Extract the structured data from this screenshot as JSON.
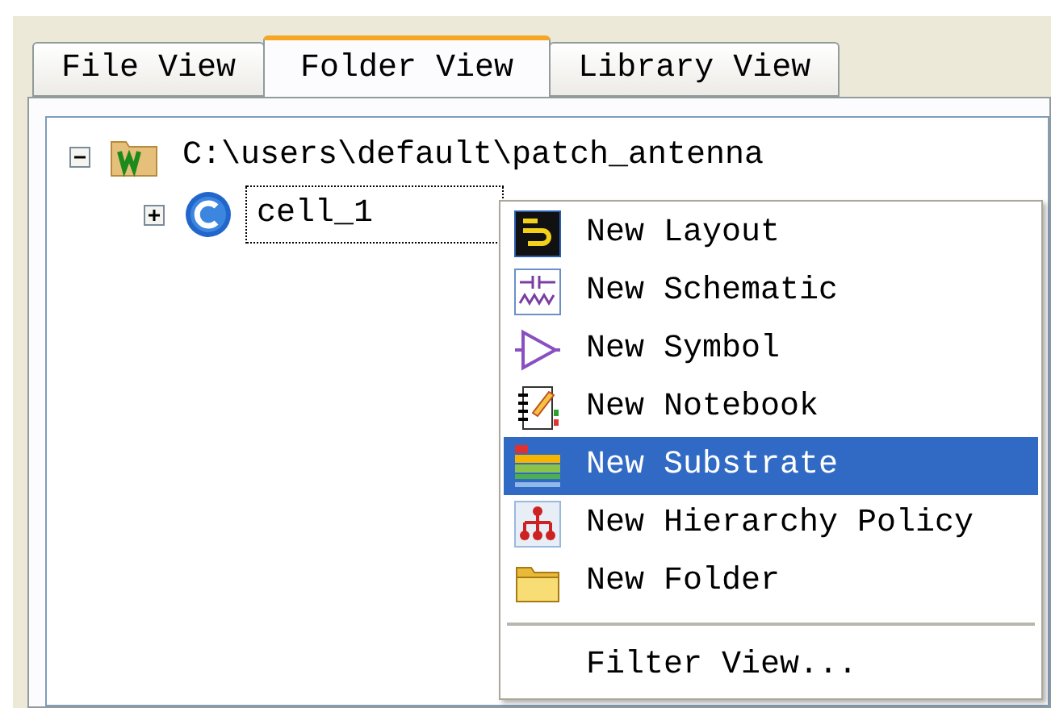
{
  "tabs": [
    {
      "label": "File View",
      "selected": false
    },
    {
      "label": "Folder View",
      "selected": true
    },
    {
      "label": "Library View",
      "selected": false
    }
  ],
  "tree": [
    {
      "label": "C:\\users\\default\\patch_antenna",
      "expanded": true,
      "focused": false,
      "children": [
        {
          "label": "cell_1",
          "expanded": false,
          "focused": true
        }
      ]
    }
  ],
  "context_menu": {
    "items": [
      {
        "kind": "command",
        "label": "New Layout",
        "selected": false
      },
      {
        "kind": "command",
        "label": "New Schematic",
        "selected": false
      },
      {
        "kind": "command",
        "label": "New Symbol",
        "selected": false
      },
      {
        "kind": "command",
        "label": "New Notebook",
        "selected": false
      },
      {
        "kind": "command",
        "label": "New Substrate",
        "selected": true
      },
      {
        "kind": "command",
        "label": "New Hierarchy Policy",
        "selected": false
      },
      {
        "kind": "command",
        "label": "New Folder",
        "selected": false
      },
      {
        "kind": "separator"
      },
      {
        "kind": "command",
        "label": "Filter View...",
        "selected": false
      }
    ]
  }
}
